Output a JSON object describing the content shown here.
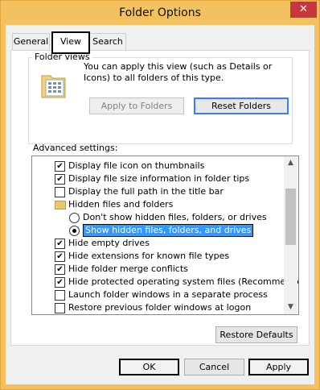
{
  "window": {
    "title": "Folder Options",
    "close_glyph": "✕",
    "colors": {
      "frame": "#f3c160",
      "close": "#c7383e",
      "selection": "#3399ff"
    }
  },
  "tabs": [
    {
      "label": "General"
    },
    {
      "label": "View"
    },
    {
      "label": "Search"
    }
  ],
  "folder_views": {
    "label": "Folder views",
    "icon": "folder-views-icon",
    "description": "You can apply this view (such as Details or Icons) to all folders of this type.",
    "apply_button": "Apply to Folders",
    "reset_button": "Reset Folders"
  },
  "advanced": {
    "label": "Advanced settings:",
    "items": [
      {
        "type": "checkbox",
        "checked": true,
        "label": "Display file icon on thumbnails"
      },
      {
        "type": "checkbox",
        "checked": true,
        "label": "Display file size information in folder tips"
      },
      {
        "type": "checkbox",
        "checked": false,
        "label": "Display the full path in the title bar"
      },
      {
        "type": "folder",
        "label": "Hidden files and folders"
      },
      {
        "type": "radio",
        "checked": false,
        "label": "Don't show hidden files, folders, or drives"
      },
      {
        "type": "radio",
        "checked": true,
        "label": "Show hidden files, folders, and drives"
      },
      {
        "type": "checkbox",
        "checked": true,
        "label": "Hide empty drives"
      },
      {
        "type": "checkbox",
        "checked": true,
        "label": "Hide extensions for known file types"
      },
      {
        "type": "checkbox",
        "checked": true,
        "label": "Hide folder merge conflicts"
      },
      {
        "type": "checkbox",
        "checked": true,
        "label": "Hide protected operating system files (Recommended)"
      },
      {
        "type": "checkbox",
        "checked": false,
        "label": "Launch folder windows in a separate process"
      },
      {
        "type": "checkbox",
        "checked": false,
        "label": "Restore previous folder windows at logon"
      }
    ],
    "restore_button": "Restore Defaults"
  },
  "footer": {
    "ok": "OK",
    "cancel": "Cancel",
    "apply": "Apply"
  },
  "check_glyph": "✔",
  "scroll_up_glyph": "▲",
  "scroll_down_glyph": "▼"
}
